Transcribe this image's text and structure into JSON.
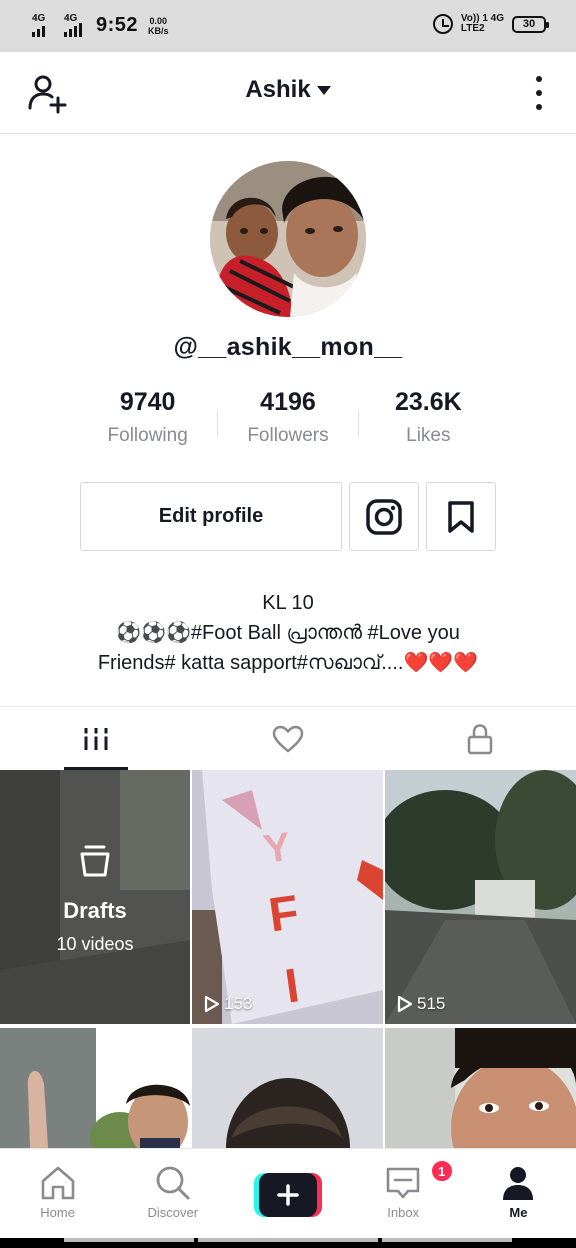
{
  "status_bar": {
    "net1": "4G",
    "net2": "4G",
    "time": "9:52",
    "speed_value": "0.00",
    "speed_unit": "KB/s",
    "volte_top": "Vo)) 1 4G",
    "volte_bottom": "LTE2",
    "battery": "30"
  },
  "header": {
    "title": "Ashik"
  },
  "profile": {
    "handle": "@__ashik__mon__",
    "stats": [
      {
        "value": "9740",
        "label": "Following"
      },
      {
        "value": "4196",
        "label": "Followers"
      },
      {
        "value": "23.6K",
        "label": "Likes"
      }
    ],
    "edit_label": "Edit profile",
    "bio_line1": "KL 10",
    "bio_line2": "⚽⚽⚽#Foot Ball പ്രാന്തൻ #Love you",
    "bio_line3": "Friends# katta sapport#സഖാവ്....❤️❤️❤️"
  },
  "grid": {
    "drafts_title": "Drafts",
    "drafts_sub": "10 videos",
    "video1_views": "153",
    "video2_views": "515"
  },
  "nav": {
    "home": "Home",
    "discover": "Discover",
    "inbox": "Inbox",
    "inbox_badge": "1",
    "me": "Me"
  },
  "colors": {
    "accent": "#fe2c55",
    "cyan": "#25f4ee",
    "text": "#161823",
    "muted": "#8a8b91"
  }
}
